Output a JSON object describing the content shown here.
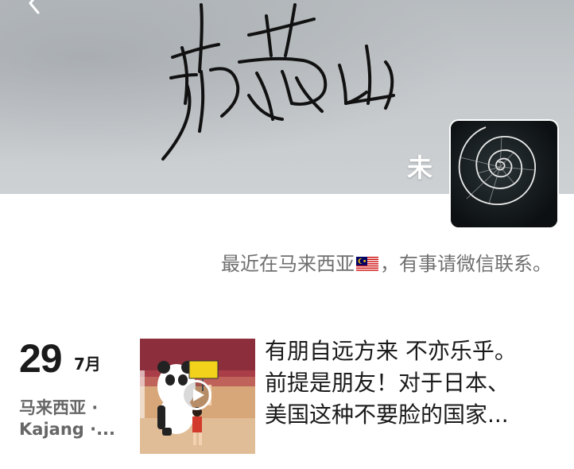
{
  "profile": {
    "nickname": "未",
    "avatar": "spiral-avatar-icon",
    "status": {
      "before_flag": "最近在马来西亚",
      "flag": "malaysia-flag-icon",
      "after_flag": "，有事请微信联系。"
    }
  },
  "post": {
    "day": "29",
    "month": "7月",
    "location_line1": "马来西亚 ·",
    "location_line2": "Kajang ·...",
    "text_lines": [
      "有朋自远方来 不亦乐乎。",
      "前提是朋友！对于日本、",
      "美国这种不要脸的国家..."
    ]
  },
  "colors": {
    "cover": "#c5c9cc",
    "text_primary": "#1a1a1a",
    "text_secondary": "#6f6f6f",
    "avatar_bg": "#121719"
  }
}
